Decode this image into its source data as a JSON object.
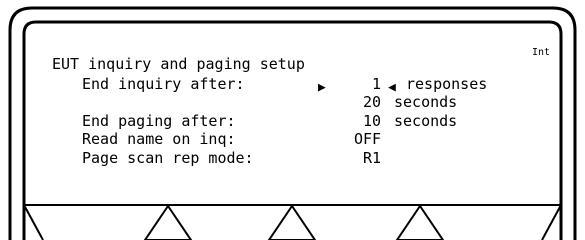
{
  "indicator": "Int",
  "title": "EUT inquiry and paging setup",
  "rows": [
    {
      "label": "End inquiry after:",
      "value": "1",
      "unit": "responses",
      "selected": true
    },
    {
      "label": "",
      "value": "20",
      "unit": "seconds"
    },
    {
      "label": "End paging after:",
      "value": "10",
      "unit": "seconds"
    },
    {
      "label": "Read name on inq:",
      "value": "OFF",
      "unit": ""
    },
    {
      "label": "Page scan rep mode:",
      "value": "R1",
      "unit": ""
    }
  ],
  "softkeys": [
    "",
    "",
    "",
    ""
  ],
  "icons": {
    "cursor-right": "▶",
    "cursor-left": "◀"
  }
}
